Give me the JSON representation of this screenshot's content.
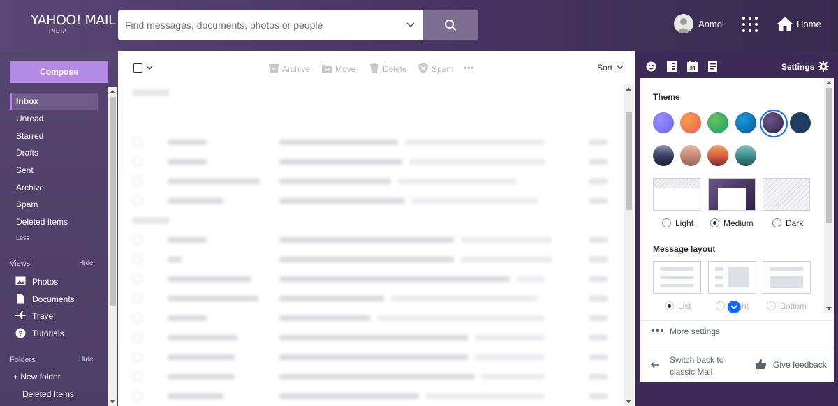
{
  "header": {
    "logo_brand": "YAHOO! MAIL",
    "logo_sub": "INDIA",
    "search_placeholder": "Find messages, documents, photos or people",
    "user_name": "Anmol",
    "home_label": "Home"
  },
  "sidebar": {
    "compose_label": "Compose",
    "folders": [
      {
        "label": "Inbox",
        "active": true
      },
      {
        "label": "Unread"
      },
      {
        "label": "Starred"
      },
      {
        "label": "Drafts"
      },
      {
        "label": "Sent"
      },
      {
        "label": "Archive"
      },
      {
        "label": "Spam"
      },
      {
        "label": "Deleted Items"
      }
    ],
    "less_label": "Less",
    "views_title": "Views",
    "views_hide": "Hide",
    "views": [
      {
        "label": "Photos",
        "icon": "photo-icon"
      },
      {
        "label": "Documents",
        "icon": "document-icon"
      },
      {
        "label": "Travel",
        "icon": "plane-icon"
      },
      {
        "label": "Tutorials",
        "icon": "help-icon"
      }
    ],
    "folders_title": "Folders",
    "folders_hide": "Hide",
    "new_folder_label": "+ New folder",
    "folder_deleted_items": "Deleted Items"
  },
  "toolbar": {
    "archive_label": "Archive",
    "move_label": "Move",
    "delete_label": "Delete",
    "spam_label": "Spam",
    "more_label": "•••",
    "sort_label": "Sort"
  },
  "right_pane": {
    "settings_label": "Settings"
  },
  "settings_panel": {
    "theme_title": "Theme",
    "theme_colors": [
      "#7a73ff",
      "#f4724c",
      "#39a86a",
      "#0a79c5",
      "#4b3766",
      "#1e3e60"
    ],
    "theme_selected_index": 4,
    "modes": [
      "Light",
      "Medium",
      "Dark"
    ],
    "mode_selected": "Medium",
    "layout_title": "Message layout",
    "layouts": [
      "List",
      "Right",
      "Bottom"
    ],
    "layout_selected": "List",
    "more_settings_label": "More settings",
    "switch_classic_label": "Switch back to classic Mail",
    "give_feedback_label": "Give feedback"
  },
  "colors": {
    "header_bg": "#4a3866",
    "sidebar_bg": "#55456e",
    "compose_bg": "#b38ae6",
    "accent_blue": "#0f69ff"
  }
}
